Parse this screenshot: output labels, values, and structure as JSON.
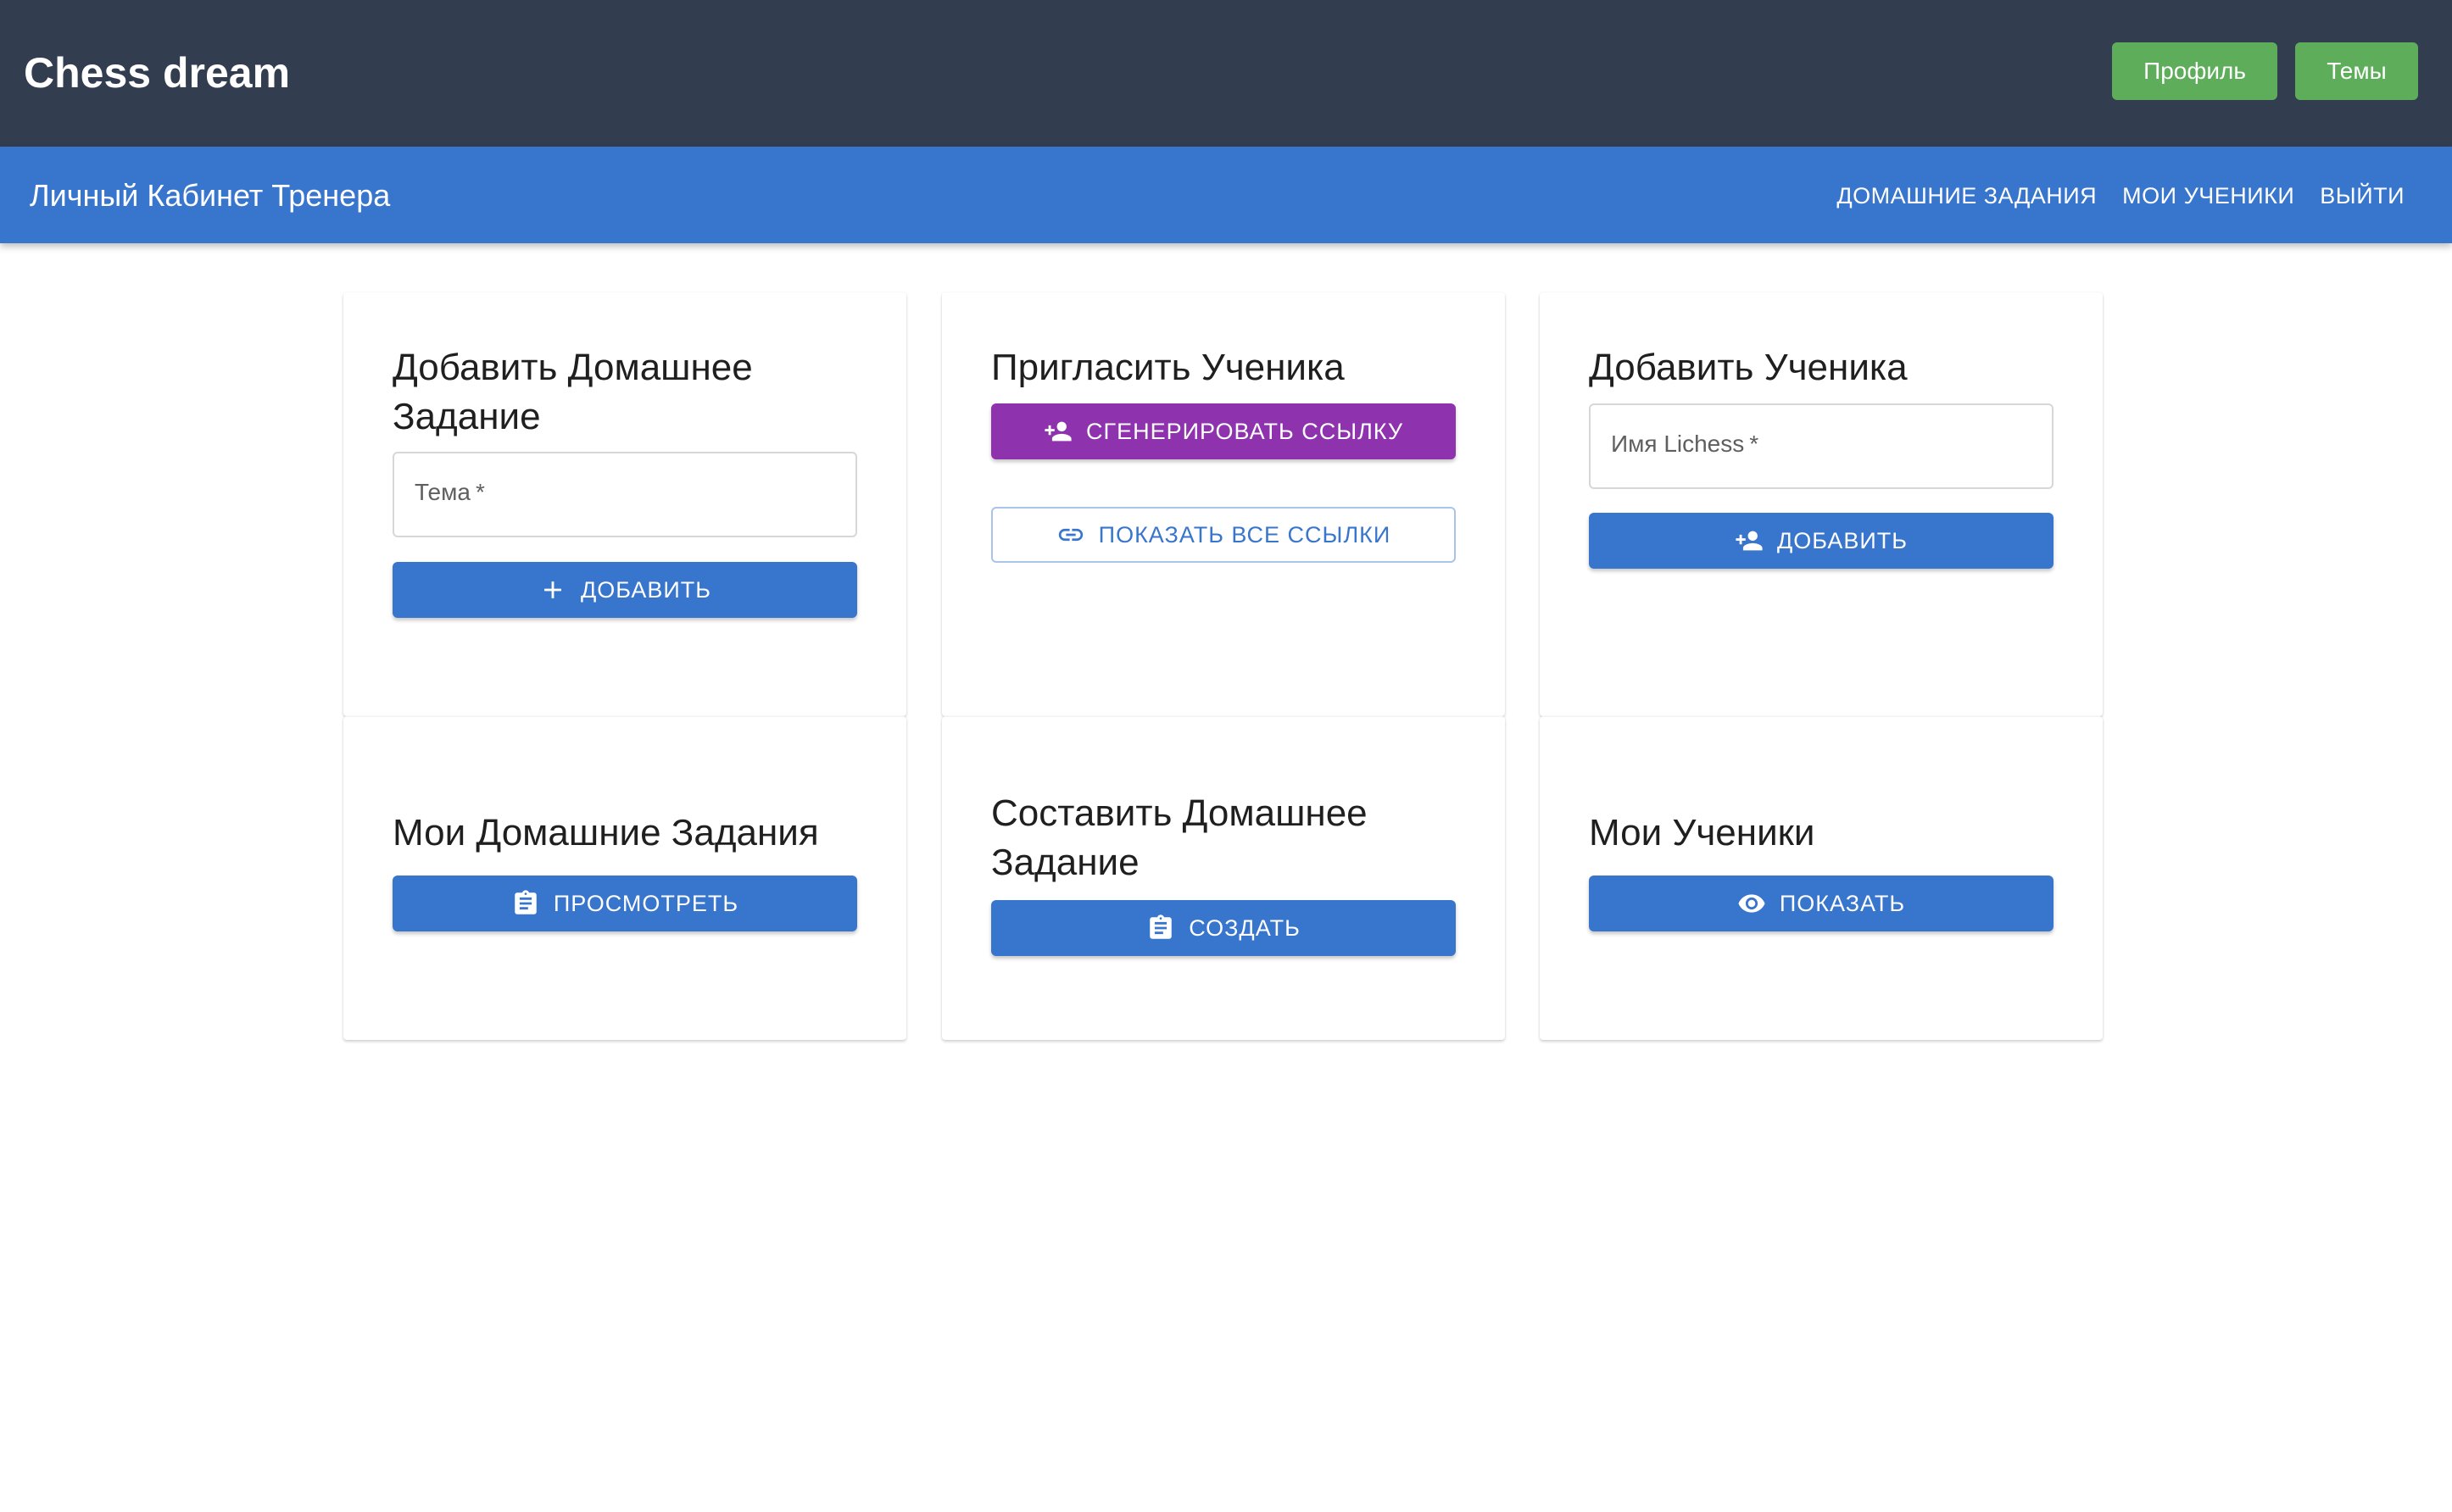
{
  "app": {
    "title": "Chess dream"
  },
  "header": {
    "profile_label": "Профиль",
    "themes_label": "Темы"
  },
  "subheader": {
    "title": "Личный Кабинет Тренера",
    "nav": [
      "ДОМАШНИЕ ЗАДАНИЯ",
      "МОИ УЧЕНИКИ",
      "ВЫЙТИ"
    ]
  },
  "cards": {
    "add_homework": {
      "title": "Добавить Домашнее Задание",
      "field_label": "Тема",
      "required_mark": "*",
      "button_label": "ДОБАВИТЬ",
      "button_icon": "plus-icon"
    },
    "invite_student": {
      "title": "Пригласить Ученика",
      "generate_label": "СГЕНЕРИРОВАТЬ ССЫЛКУ",
      "generate_icon": "person-add-icon",
      "show_links_label": "ПОКАЗАТЬ ВСЕ ССЫЛКИ",
      "show_links_icon": "link-icon"
    },
    "add_student": {
      "title": "Добавить Ученика",
      "field_label": "Имя Lichess",
      "required_mark": "*",
      "button_label": "ДОБАВИТЬ",
      "button_icon": "person-add-icon"
    },
    "my_homework": {
      "title": "Мои Домашние Задания",
      "button_label": "ПРОСМОТРЕТЬ",
      "button_icon": "clipboard-icon"
    },
    "compose_homework": {
      "title": "Составить Домашнее Задание",
      "button_label": "СОЗДАТЬ",
      "button_icon": "clipboard-icon"
    },
    "my_students": {
      "title": "Мои Ученики",
      "button_label": "ПОКАЗАТЬ",
      "button_icon": "eye-icon"
    }
  },
  "colors": {
    "topbar": "#323d4f",
    "primary": "#3875cc",
    "secondary": "#8f32ae",
    "success": "#5ead5b"
  }
}
